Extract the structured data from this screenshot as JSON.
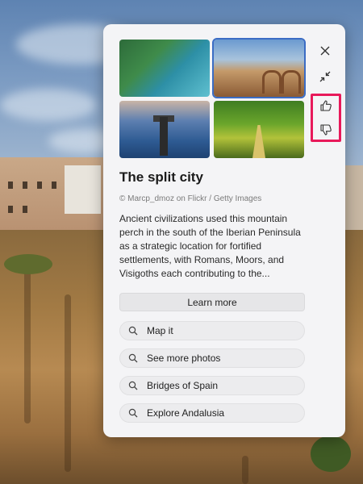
{
  "card": {
    "title": "The split city",
    "credit": "© Marcp_dmoz on Flickr / Getty Images",
    "description": "Ancient civilizations used this mountain perch in the south of the Iberian Peninsula as a strategic location for fortified settlements, with Romans, Moors, and Visigoths each contributing to the...",
    "learn_more_label": "Learn more",
    "thumbnails": [
      "beach-cliff-thumbnail",
      "ronda-bridge-thumbnail",
      "pier-sunset-thumbnail",
      "bamboo-forest-thumbnail"
    ],
    "suggestions": [
      {
        "label": "Map it"
      },
      {
        "label": "See more photos"
      },
      {
        "label": "Bridges of Spain"
      },
      {
        "label": "Explore Andalusia"
      }
    ]
  },
  "controls": {
    "close_icon": "close-icon",
    "collapse_icon": "collapse-icon",
    "like_icon": "thumbs-up-icon",
    "dislike_icon": "thumbs-down-icon",
    "highlight_color": "#e8195a"
  }
}
